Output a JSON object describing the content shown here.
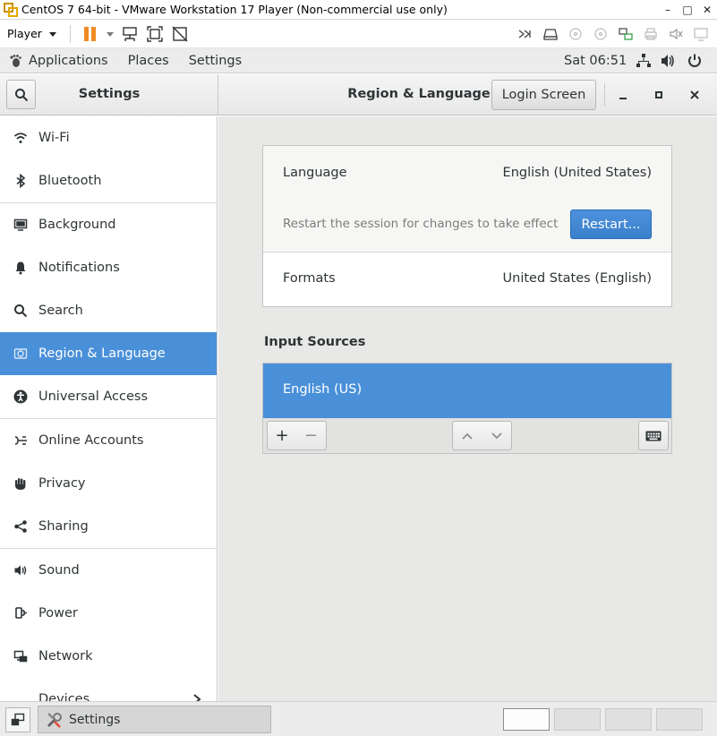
{
  "vm": {
    "title": "CentOS 7 64-bit - VMware Workstation 17 Player (Non-commercial use only)",
    "player_label": "Player",
    "controls": [
      "–",
      "□",
      "✕"
    ]
  },
  "gnome": {
    "applications": "Applications",
    "places": "Places",
    "settings": "Settings",
    "clock": "Sat 06:51"
  },
  "header": {
    "left_title": "Settings",
    "title": "Region & Language",
    "login_screen": "Login Screen"
  },
  "sidebar": {
    "items": [
      {
        "label": "Wi-Fi",
        "icon": "wifi-icon"
      },
      {
        "label": "Bluetooth",
        "icon": "bluetooth-icon"
      },
      {
        "label": "Background",
        "icon": "background-icon"
      },
      {
        "label": "Notifications",
        "icon": "bell-icon"
      },
      {
        "label": "Search",
        "icon": "search-icon"
      },
      {
        "label": "Region & Language",
        "icon": "region-icon"
      },
      {
        "label": "Universal Access",
        "icon": "accessibility-icon"
      },
      {
        "label": "Online Accounts",
        "icon": "online-accounts-icon"
      },
      {
        "label": "Privacy",
        "icon": "hand-icon"
      },
      {
        "label": "Sharing",
        "icon": "share-icon"
      },
      {
        "label": "Sound",
        "icon": "speaker-icon"
      },
      {
        "label": "Power",
        "icon": "power-plug-icon"
      },
      {
        "label": "Network",
        "icon": "network-icon"
      },
      {
        "label": "Devices",
        "icon": "chevron-right-icon"
      }
    ],
    "active_index": 5
  },
  "main": {
    "language_label": "Language",
    "language_value": "English (United States)",
    "restart_note": "Restart the session for changes to take effect",
    "restart_button": "Restart...",
    "formats_label": "Formats",
    "formats_value": "United States (English)",
    "input_sources_title": "Input Sources",
    "input_sources": [
      "English (US)"
    ],
    "add_label": "+",
    "remove_label": "−"
  },
  "taskbar": {
    "task_label": "Settings",
    "workspaces": 4,
    "active_workspace": 1
  },
  "colors": {
    "accent": "#4a90d9",
    "restart": "#3a82cf",
    "pause": "#f08a24"
  }
}
